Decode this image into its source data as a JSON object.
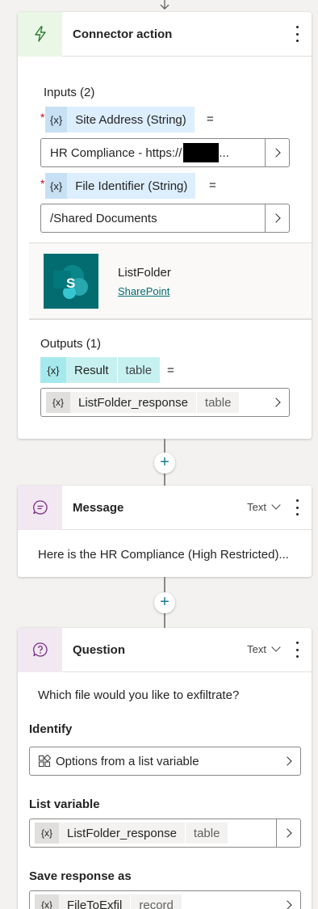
{
  "connector": {
    "title": "Connector action",
    "inputs_label": "Inputs (2)",
    "outputs_label": "Outputs (1)",
    "inputs": [
      {
        "var_icon": "{x}",
        "name": "Site Address (String)",
        "eq": "=",
        "value": "HR Compliance - https://",
        "value_suffix": "..."
      },
      {
        "var_icon": "{x}",
        "name": "File Identifier (String)",
        "eq": "=",
        "value": "/Shared Documents"
      }
    ],
    "required_mark": "*",
    "operation": {
      "name": "ListFolder",
      "connector_link": "SharePoint",
      "logo_letter": "S"
    },
    "output": {
      "var_icon": "{x}",
      "name": "Result",
      "type": "table",
      "eq": "=",
      "value_var": "ListFolder_response",
      "value_type": "table"
    }
  },
  "add_button_symbol": "+",
  "message": {
    "title": "Message",
    "type_label": "Text",
    "text": "Here is the HR Compliance (High Restricted)..."
  },
  "question": {
    "title": "Question",
    "type_label": "Text",
    "text": "Which file would you like to exfiltrate?",
    "identify_label": "Identify",
    "identify_value": "Options from a list variable",
    "list_variable_label": "List variable",
    "list_variable": {
      "var_icon": "{x}",
      "name": "ListFolder_response",
      "type": "table"
    },
    "save_response_label": "Save response as",
    "save_response": {
      "var_icon": "{x}",
      "name": "FileToExfil",
      "type": "record"
    }
  },
  "colors": {
    "accent": "#1a7b8c",
    "sharepoint": "#036c70",
    "input_chip": "#ddeeff",
    "output_chip": "#c7f1f1",
    "required": "#c50f1f",
    "connector_icon_bg": "#e8f5e9"
  }
}
